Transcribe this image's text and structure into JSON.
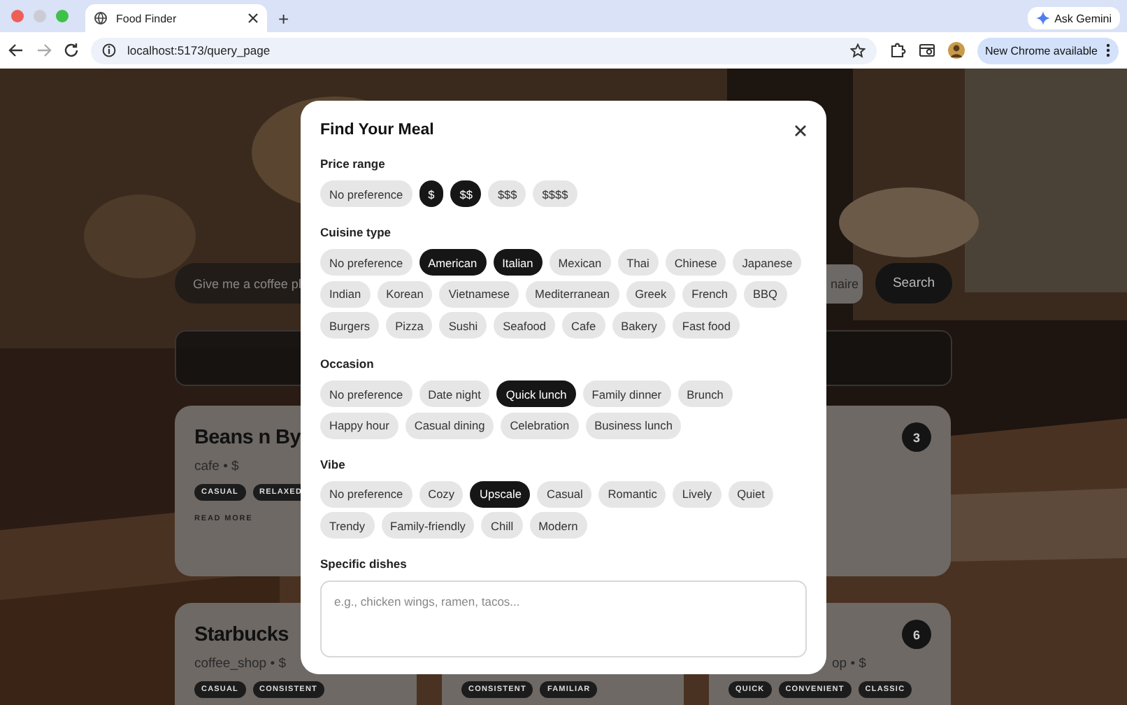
{
  "browser": {
    "tab": {
      "title": "Food Finder",
      "selected": true
    },
    "new_tab": "+",
    "address": "localhost:5173/query_page",
    "ask_gemini": "Ask Gemini",
    "update_button": "New Chrome available"
  },
  "page": {
    "search": {
      "placeholder": "Give me a coffee pl"
    },
    "questionnaire_button": "naire",
    "search_button": "Search",
    "results": [
      {
        "cards": [
          {
            "title": "Beans n By",
            "meta": "cafe • $",
            "tags": [
              "CASUAL",
              "RELAXED"
            ],
            "link": "READ MORE"
          },
          {
            "rank": "3"
          }
        ]
      },
      {
        "cards": [
          {
            "title": "Starbucks",
            "meta": "coffee_shop • $",
            "tags": [
              "CASUAL",
              "CONSISTENT"
            ]
          },
          {
            "tags": [
              "CONSISTENT",
              "FAMILIAR"
            ]
          },
          {
            "rank": "6",
            "meta": "op • $",
            "tags": [
              "QUICK",
              "CONVENIENT",
              "CLASSIC"
            ]
          }
        ]
      }
    ]
  },
  "modal": {
    "title": "Find Your Meal",
    "sections": [
      {
        "label": "Price range",
        "options": [
          {
            "label": "No preference",
            "selected": false
          },
          {
            "label": "$",
            "selected": true
          },
          {
            "label": "$$",
            "selected": true
          },
          {
            "label": "$$$",
            "selected": false
          },
          {
            "label": "$$$$",
            "selected": false
          }
        ]
      },
      {
        "label": "Cuisine type",
        "options": [
          {
            "label": "No preference",
            "selected": false
          },
          {
            "label": "American",
            "selected": true
          },
          {
            "label": "Italian",
            "selected": true
          },
          {
            "label": "Mexican",
            "selected": false
          },
          {
            "label": "Thai",
            "selected": false
          },
          {
            "label": "Chinese",
            "selected": false
          },
          {
            "label": "Japanese",
            "selected": false
          },
          {
            "label": "Indian",
            "selected": false
          },
          {
            "label": "Korean",
            "selected": false
          },
          {
            "label": "Vietnamese",
            "selected": false
          },
          {
            "label": "Mediterranean",
            "selected": false
          },
          {
            "label": "Greek",
            "selected": false
          },
          {
            "label": "French",
            "selected": false
          },
          {
            "label": "BBQ",
            "selected": false
          },
          {
            "label": "Burgers",
            "selected": false
          },
          {
            "label": "Pizza",
            "selected": false
          },
          {
            "label": "Sushi",
            "selected": false
          },
          {
            "label": "Seafood",
            "selected": false
          },
          {
            "label": "Cafe",
            "selected": false
          },
          {
            "label": "Bakery",
            "selected": false
          },
          {
            "label": "Fast food",
            "selected": false
          }
        ]
      },
      {
        "label": "Occasion",
        "options": [
          {
            "label": "No preference",
            "selected": false
          },
          {
            "label": "Date night",
            "selected": false
          },
          {
            "label": "Quick lunch",
            "selected": true
          },
          {
            "label": "Family dinner",
            "selected": false
          },
          {
            "label": "Brunch",
            "selected": false
          },
          {
            "label": "Happy hour",
            "selected": false
          },
          {
            "label": "Casual dining",
            "selected": false
          },
          {
            "label": "Celebration",
            "selected": false
          },
          {
            "label": "Business lunch",
            "selected": false
          }
        ]
      },
      {
        "label": "Vibe",
        "options": [
          {
            "label": "No preference",
            "selected": false
          },
          {
            "label": "Cozy",
            "selected": false
          },
          {
            "label": "Upscale",
            "selected": true
          },
          {
            "label": "Casual",
            "selected": false
          },
          {
            "label": "Romantic",
            "selected": false
          },
          {
            "label": "Lively",
            "selected": false
          },
          {
            "label": "Quiet",
            "selected": false
          },
          {
            "label": "Trendy",
            "selected": false
          },
          {
            "label": "Family-friendly",
            "selected": false
          },
          {
            "label": "Chill",
            "selected": false
          },
          {
            "label": "Modern",
            "selected": false
          }
        ]
      }
    ],
    "dishes": {
      "label": "Specific dishes",
      "placeholder": "e.g., chicken wings, ramen, tacos..."
    }
  }
}
